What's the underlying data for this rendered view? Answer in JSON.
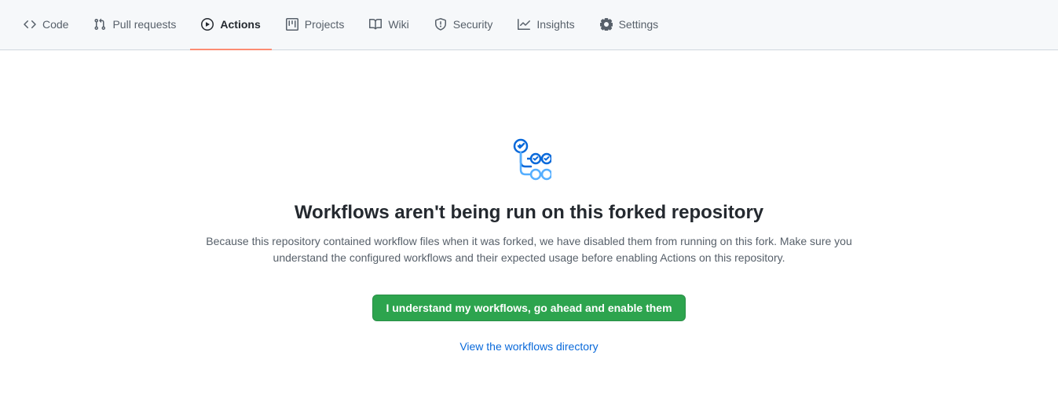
{
  "nav": {
    "tabs": [
      {
        "label": "Code"
      },
      {
        "label": "Pull requests"
      },
      {
        "label": "Actions"
      },
      {
        "label": "Projects"
      },
      {
        "label": "Wiki"
      },
      {
        "label": "Security"
      },
      {
        "label": "Insights"
      },
      {
        "label": "Settings"
      }
    ]
  },
  "main": {
    "heading": "Workflows aren't being run on this forked repository",
    "description": "Because this repository contained workflow files when it was forked, we have disabled them from running on this fork. Make sure you understand the configured workflows and their expected usage before enabling Actions on this repository.",
    "enable_button": "I understand my workflows, go ahead and enable them",
    "view_link": "View the workflows directory"
  }
}
